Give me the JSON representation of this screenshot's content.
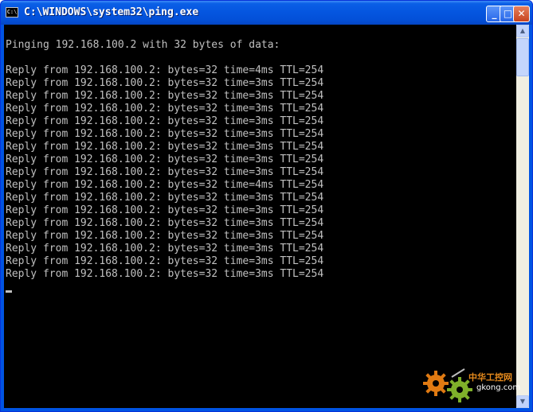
{
  "window": {
    "title": "C:\\WINDOWS\\system32\\ping.exe",
    "icon": "cmd-console-icon",
    "icon_label": "C:\\",
    "controls": {
      "minimize": "_",
      "maximize": "□",
      "close": "✕"
    }
  },
  "console": {
    "header": "Pinging 192.168.100.2 with 32 bytes of data:",
    "replies": [
      "Reply from 192.168.100.2: bytes=32 time=4ms TTL=254",
      "Reply from 192.168.100.2: bytes=32 time=3ms TTL=254",
      "Reply from 192.168.100.2: bytes=32 time=3ms TTL=254",
      "Reply from 192.168.100.2: bytes=32 time=3ms TTL=254",
      "Reply from 192.168.100.2: bytes=32 time=3ms TTL=254",
      "Reply from 192.168.100.2: bytes=32 time=3ms TTL=254",
      "Reply from 192.168.100.2: bytes=32 time=3ms TTL=254",
      "Reply from 192.168.100.2: bytes=32 time=3ms TTL=254",
      "Reply from 192.168.100.2: bytes=32 time=3ms TTL=254",
      "Reply from 192.168.100.2: bytes=32 time=4ms TTL=254",
      "Reply from 192.168.100.2: bytes=32 time=3ms TTL=254",
      "Reply from 192.168.100.2: bytes=32 time=3ms TTL=254",
      "Reply from 192.168.100.2: bytes=32 time=3ms TTL=254",
      "Reply from 192.168.100.2: bytes=32 time=3ms TTL=254",
      "Reply from 192.168.100.2: bytes=32 time=3ms TTL=254",
      "Reply from 192.168.100.2: bytes=32 time=3ms TTL=254",
      "Reply from 192.168.100.2: bytes=32 time=3ms TTL=254"
    ]
  },
  "scrollbar": {
    "up_arrow": "▲",
    "down_arrow": "▼"
  },
  "watermark": {
    "brand": "中华工控网",
    "domain": "gkong.com"
  },
  "colors": {
    "titlebar": "#0054e3",
    "console_bg": "#000000",
    "console_text": "#c0c0c0",
    "close_button": "#c7431f"
  }
}
